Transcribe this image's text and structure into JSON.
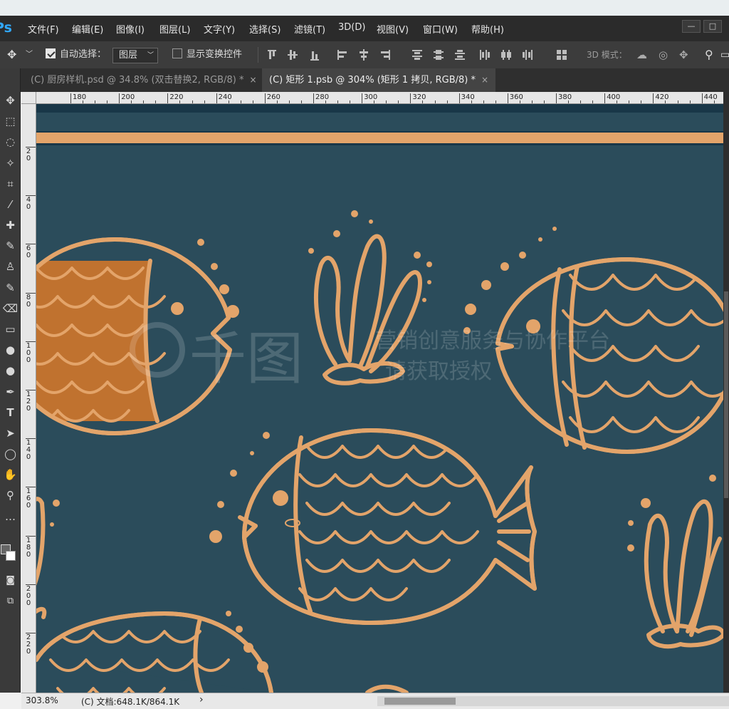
{
  "app": {
    "logo": "Ps"
  },
  "menu": [
    "文件(F)",
    "编辑(E)",
    "图像(I)",
    "图层(L)",
    "文字(Y)",
    "选择(S)",
    "滤镜(T)",
    "3D(D)",
    "视图(V)",
    "窗口(W)",
    "帮助(H)"
  ],
  "window_buttons": {
    "minimize": "—",
    "restore": "□"
  },
  "options": {
    "auto_select_label": "自动选择：",
    "auto_select_value": "图层",
    "show_transform_label": "显示变换控件",
    "mode_3d_label": "3D 模式："
  },
  "tabs": [
    {
      "label": "(C) 厨房样机.psd @ 34.8% (双击替换2, RGB/8) *",
      "close": "×"
    },
    {
      "label": "(C) 矩形 1.psb @ 304% (矩形 1 拷贝, RGB/8) *",
      "close": "×"
    }
  ],
  "ruler_top": [
    "180",
    "200",
    "220",
    "240",
    "260",
    "280",
    "300",
    "320",
    "340",
    "360",
    "380",
    "400",
    "420",
    "440"
  ],
  "ruler_left": [
    "2\n0",
    "4\n0",
    "6\n0",
    "8\n0",
    "1\n0\n0",
    "1\n2\n0",
    "1\n4\n0",
    "1\n6\n0",
    "1\n8\n0",
    "2\n0\n0",
    "2\n2\n0"
  ],
  "tools": [
    "move-tool",
    "marquee-tool",
    "lasso-tool",
    "magic-wand-tool",
    "crop-tool",
    "eyedropper-tool",
    "healing-tool",
    "brush-tool",
    "stamp-tool",
    "history-brush-tool",
    "eraser-tool",
    "gradient-tool",
    "blur-tool",
    "dodge-tool",
    "pen-tool",
    "type-tool",
    "path-select-tool",
    "shape-tool",
    "hand-tool",
    "zoom-tool",
    "more-tools"
  ],
  "tool_glyphs": [
    "✥",
    "⬚",
    "◌",
    "✧",
    "⌗",
    "⁄",
    "✚",
    "✎",
    "♙",
    "✎",
    "⌫",
    "▭",
    "●",
    "●",
    "✒",
    "T",
    "➤",
    "◯",
    "✋",
    "⚲",
    "…"
  ],
  "watermark": {
    "text1": "千图",
    "text2": "营销创意服务与协作平台",
    "text3": "请获取授权"
  },
  "status": {
    "zoom": "303.8%",
    "doc": "(C) 文档:648.1K/864.1K",
    "arrow": "›"
  },
  "colors": {
    "canvas_bg": "#2b4c5b",
    "pattern": "#e3a46a",
    "scales_fill": "#c0722f",
    "stripe_dark": "#193748"
  }
}
